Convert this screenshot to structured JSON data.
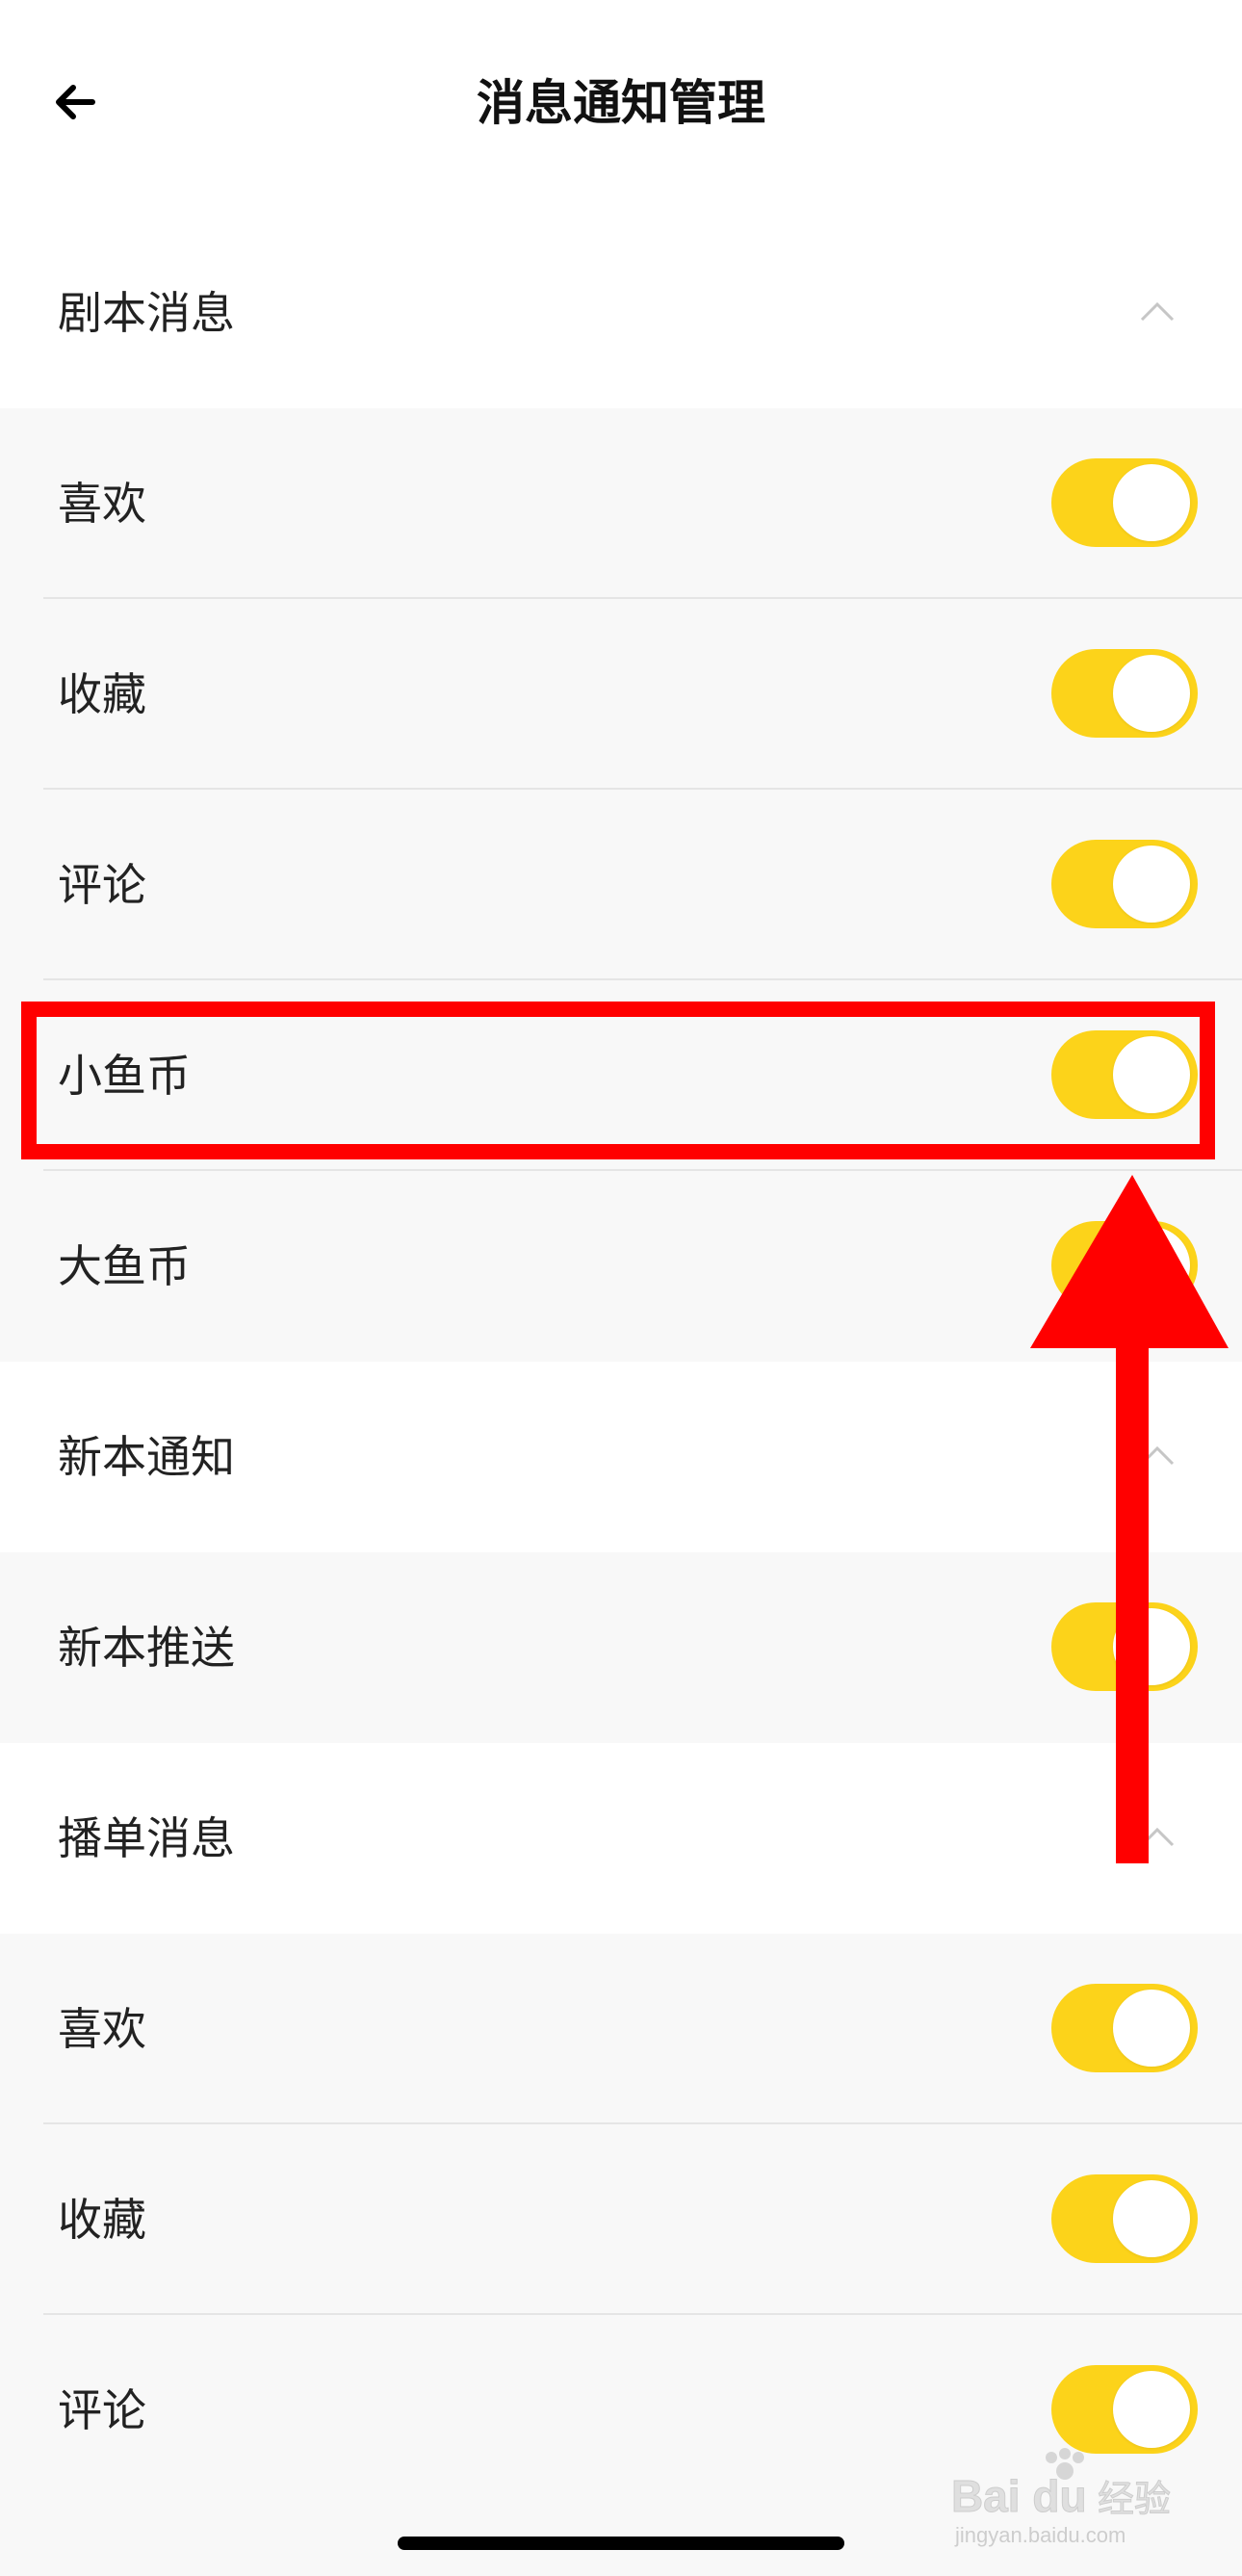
{
  "header": {
    "title": "消息通知管理",
    "back_icon": "back-arrow-icon"
  },
  "sections": [
    {
      "title": "剧本消息",
      "expanded": true,
      "items": [
        {
          "label": "喜欢",
          "on": true
        },
        {
          "label": "收藏",
          "on": true
        },
        {
          "label": "评论",
          "on": true
        },
        {
          "label": "小鱼币",
          "on": true
        },
        {
          "label": "大鱼币",
          "on": true
        }
      ]
    },
    {
      "title": "新本通知",
      "expanded": true,
      "items": [
        {
          "label": "新本推送",
          "on": true
        }
      ]
    },
    {
      "title": "播单消息",
      "expanded": true,
      "items": [
        {
          "label": "喜欢",
          "on": true
        },
        {
          "label": "收藏",
          "on": true
        },
        {
          "label": "评论",
          "on": true
        }
      ]
    }
  ],
  "watermark": {
    "brand": "Bai du",
    "chinese": "经验",
    "url": "jingyan.baidu.com"
  },
  "colors": {
    "toggle_on": "#fcd31a",
    "annotation": "#ff0000",
    "row_bg": "#f8f8f8"
  }
}
